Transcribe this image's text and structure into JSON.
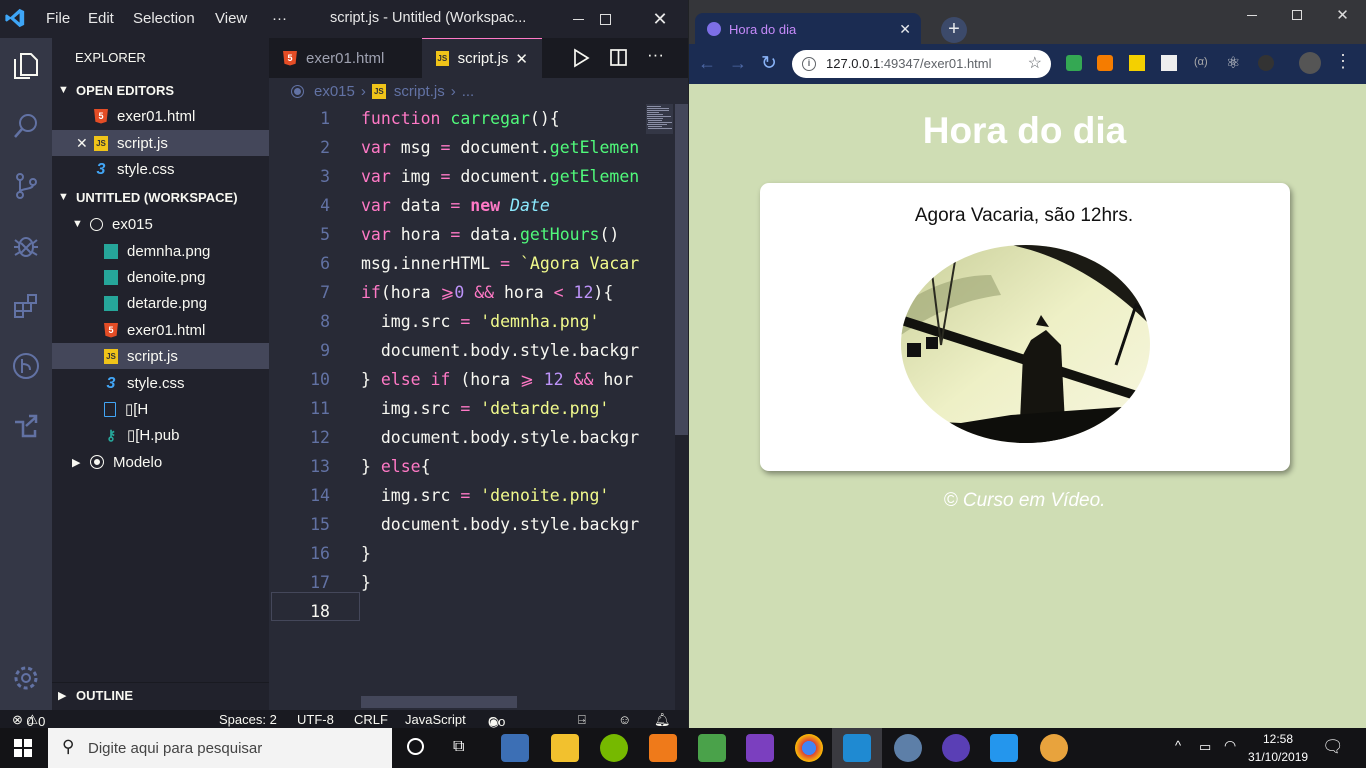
{
  "vscode": {
    "menu": [
      "File",
      "Edit",
      "Selection",
      "View",
      "···"
    ],
    "window_title": "script.js - Untitled (Workspac...",
    "sidebar": {
      "explorer_label": "EXPLORER",
      "open_editors_label": "OPEN EDITORS",
      "open_editors": [
        "exer01.html",
        "script.js",
        "style.css"
      ],
      "workspace_label": "UNTITLED (WORKSPACE)",
      "folder": "ex015",
      "files": [
        "demnha.png",
        "denoite.png",
        "detarde.png",
        "exer01.html",
        "script.js",
        "style.css",
        "▯[H",
        "▯[H.pub"
      ],
      "folder2": "Modelo",
      "outline_label": "OUTLINE"
    },
    "tabs": [
      "exer01.html",
      "script.js"
    ],
    "breadcrumb": [
      "ex015",
      "script.js",
      "..."
    ],
    "line_numbers": [
      "1",
      "2",
      "3",
      "4",
      "5",
      "6",
      "7",
      "8",
      "9",
      "10",
      "11",
      "12",
      "13",
      "14",
      "15",
      "16",
      "17",
      "18"
    ],
    "status": {
      "errors": "0",
      "warnings": "0",
      "spaces": "Spaces: 2",
      "encoding": "UTF-8",
      "eol": "CRLF",
      "language": "JavaScript",
      "golive": "Go Live"
    }
  },
  "chrome": {
    "tab_title": "Hora do dia",
    "url_host": "127.0.0.1",
    "url_rest": ":49347/exer01.html",
    "page": {
      "heading": "Hora do dia",
      "message": "Agora Vacaria, são 12hrs.",
      "footer": "© Curso em Vídeo."
    }
  },
  "taskbar": {
    "search_placeholder": "Digite aqui para pesquisar",
    "time": "12:58",
    "date": "31/10/2019"
  },
  "colors": {
    "vscode_bg": "#282a36",
    "page_bg": "#cfddb4",
    "chrome_frame": "#1b2c52"
  }
}
